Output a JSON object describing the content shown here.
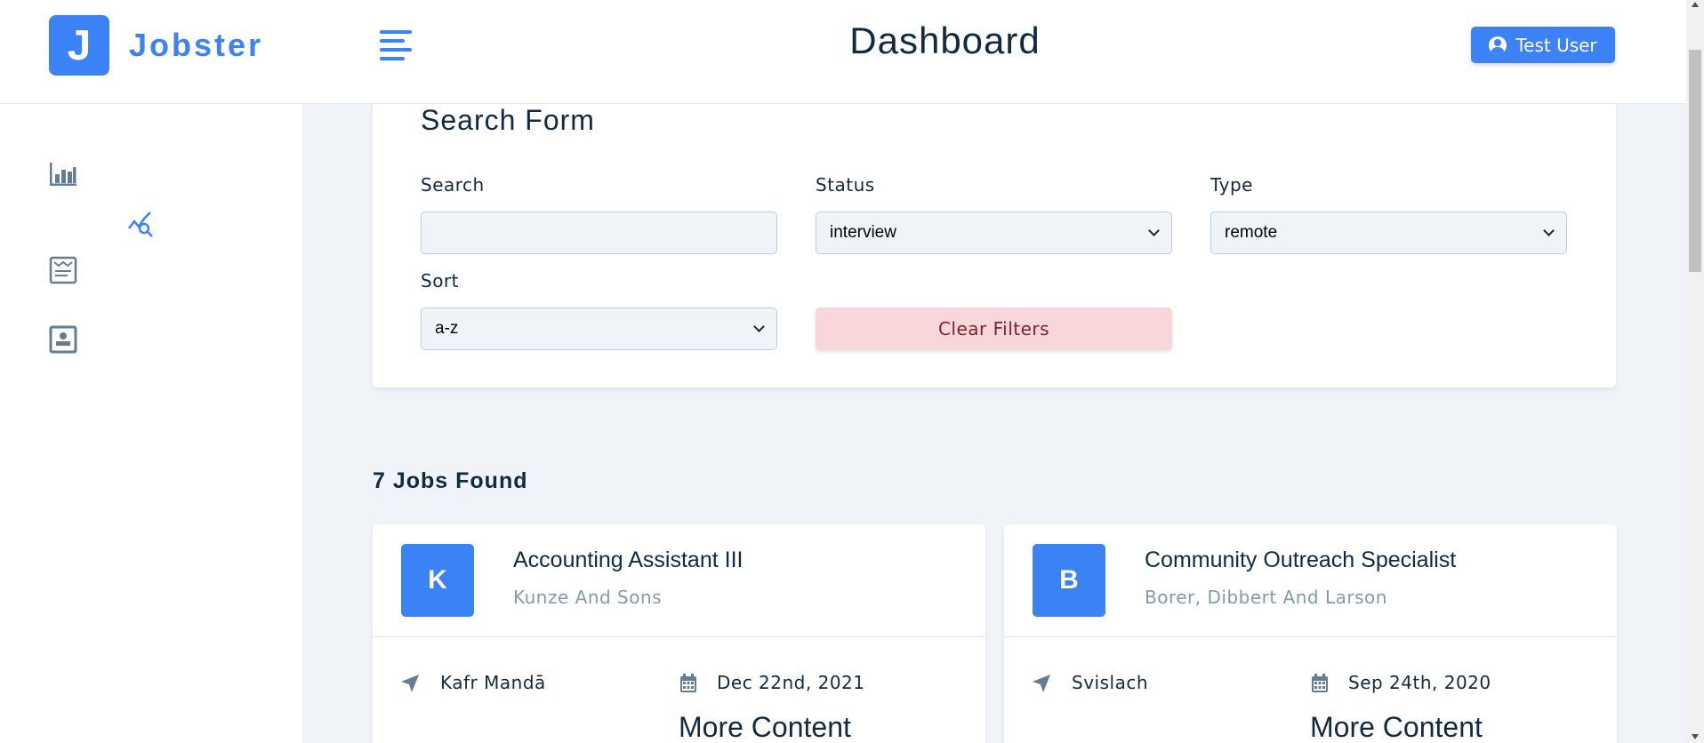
{
  "brand": {
    "logo_letter": "J",
    "name": "Jobster"
  },
  "header": {
    "title": "Dashboard",
    "user_button": "Test User"
  },
  "sidebar": {
    "items": [
      {
        "name": "stats",
        "icon": "bar-chart-icon"
      },
      {
        "name": "all-jobs",
        "icon": "query-stats-icon",
        "active": true
      },
      {
        "name": "add-job",
        "icon": "form-icon"
      },
      {
        "name": "profile",
        "icon": "profile-icon"
      }
    ]
  },
  "search_form": {
    "title": "Search Form",
    "search_label": "Search",
    "search_value": "",
    "status_label": "Status",
    "status_value": "interview",
    "type_label": "Type",
    "type_value": "remote",
    "sort_label": "Sort",
    "sort_value": "a-z",
    "clear_button": "Clear Filters"
  },
  "jobs_found": "7 Jobs Found",
  "jobs": [
    {
      "initial": "K",
      "position": "Accounting Assistant III",
      "company": "Kunze And Sons",
      "location": "Kafr Mandā",
      "date": "Dec 22nd, 2021",
      "more": "More Content"
    },
    {
      "initial": "B",
      "position": "Community Outreach Specialist",
      "company": "Borer, Dibbert And Larson",
      "location": "Svislach",
      "date": "Sep 24th, 2020",
      "more": "More Content"
    }
  ],
  "colors": {
    "primary": "#3b82f6",
    "danger_bg": "#f8d7da",
    "danger_text": "#842029",
    "background": "#f0f4f8"
  }
}
